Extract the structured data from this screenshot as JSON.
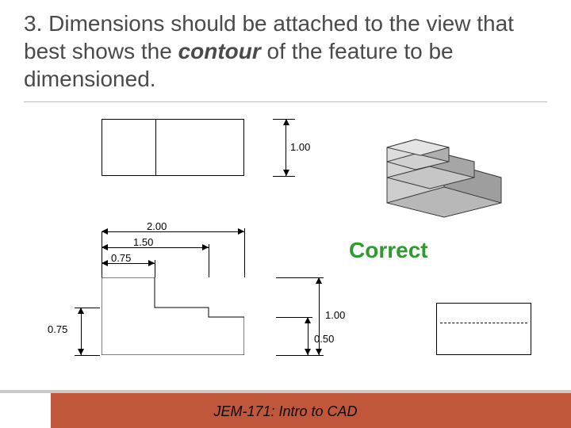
{
  "heading": {
    "number": "3.",
    "text_before": "Dimensions should be attached to the view that best shows the ",
    "emphasis": "contour",
    "text_after": " of the feature to be dimensioned."
  },
  "dimensions": {
    "top_height": "1.00",
    "width_full": "2.00",
    "width_mid": "1.50",
    "width_small": "0.75",
    "step_height_small": "0.75",
    "overall_height": "1.00",
    "ledge_height": "0.50"
  },
  "labels": {
    "correct": "Correct"
  },
  "footer": {
    "course": "JEM-171: Intro to CAD"
  }
}
